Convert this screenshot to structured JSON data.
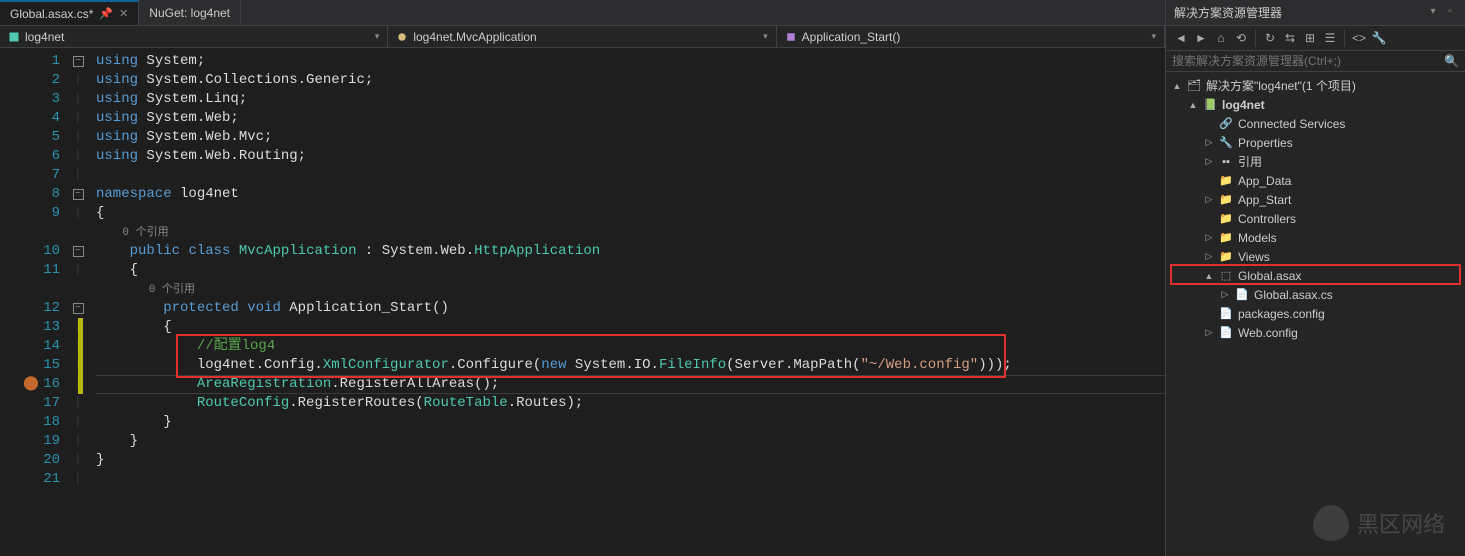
{
  "tabs": [
    {
      "label": "Global.asax.cs*",
      "active": true
    },
    {
      "label": "NuGet: log4net",
      "active": false
    }
  ],
  "navbar": {
    "project": "log4net",
    "class": "log4net.MvcApplication",
    "method": "Application_Start()"
  },
  "refs_text": "0 个引用",
  "code_lines": [
    {
      "n": 1,
      "tokens": [
        {
          "t": "k",
          "v": "using"
        },
        {
          "v": " System;"
        }
      ],
      "fold": "box"
    },
    {
      "n": 2,
      "tokens": [
        {
          "t": "k",
          "v": "using"
        },
        {
          "v": " System.Collections.Generic;"
        }
      ]
    },
    {
      "n": 3,
      "tokens": [
        {
          "t": "k",
          "v": "using"
        },
        {
          "v": " System.Linq;"
        }
      ]
    },
    {
      "n": 4,
      "tokens": [
        {
          "t": "k",
          "v": "using"
        },
        {
          "v": " System.Web;"
        }
      ]
    },
    {
      "n": 5,
      "tokens": [
        {
          "t": "k",
          "v": "using"
        },
        {
          "v": " System.Web.Mvc;"
        }
      ]
    },
    {
      "n": 6,
      "tokens": [
        {
          "t": "k",
          "v": "using"
        },
        {
          "v": " System.Web.Routing;"
        }
      ]
    },
    {
      "n": 7,
      "tokens": []
    },
    {
      "n": 8,
      "tokens": [
        {
          "t": "k",
          "v": "namespace"
        },
        {
          "v": " log4net"
        }
      ],
      "fold": "box"
    },
    {
      "n": 9,
      "tokens": [
        {
          "v": "{"
        }
      ]
    },
    {
      "ref": true
    },
    {
      "n": 10,
      "tokens": [
        {
          "v": "    "
        },
        {
          "t": "k",
          "v": "public"
        },
        {
          "v": " "
        },
        {
          "t": "k",
          "v": "class"
        },
        {
          "v": " "
        },
        {
          "t": "t",
          "v": "MvcApplication"
        },
        {
          "v": " : System.Web."
        },
        {
          "t": "t",
          "v": "HttpApplication"
        }
      ],
      "fold": "box"
    },
    {
      "n": 11,
      "tokens": [
        {
          "v": "    {"
        }
      ]
    },
    {
      "ref": true,
      "indent": "        "
    },
    {
      "n": 12,
      "tokens": [
        {
          "v": "        "
        },
        {
          "t": "k",
          "v": "protected"
        },
        {
          "v": " "
        },
        {
          "t": "k",
          "v": "void"
        },
        {
          "v": " Application_Start()"
        }
      ],
      "fold": "box"
    },
    {
      "n": 13,
      "tokens": [
        {
          "v": "        {"
        }
      ],
      "change": true
    },
    {
      "n": 14,
      "tokens": [
        {
          "v": "            "
        },
        {
          "t": "c",
          "v": "//配置log4"
        }
      ],
      "change": true,
      "hl": "start"
    },
    {
      "n": 15,
      "tokens": [
        {
          "v": "            log4net.Config."
        },
        {
          "t": "t",
          "v": "XmlConfigurator"
        },
        {
          "v": ".Configure("
        },
        {
          "t": "k",
          "v": "new"
        },
        {
          "v": " System.IO."
        },
        {
          "t": "t",
          "v": "FileInfo"
        },
        {
          "v": "(Server.MapPath("
        },
        {
          "t": "s",
          "v": "\"~/Web.config\""
        },
        {
          "v": ")));"
        }
      ],
      "change": true,
      "bp": true,
      "cur": true,
      "hl": "end"
    },
    {
      "n": 16,
      "tokens": [
        {
          "v": "            "
        },
        {
          "t": "t",
          "v": "AreaRegistration"
        },
        {
          "v": ".RegisterAllAreas();"
        }
      ],
      "change": true
    },
    {
      "n": 17,
      "tokens": [
        {
          "v": "            "
        },
        {
          "t": "t",
          "v": "RouteConfig"
        },
        {
          "v": ".RegisterRoutes("
        },
        {
          "t": "t",
          "v": "RouteTable"
        },
        {
          "v": ".Routes);"
        }
      ]
    },
    {
      "n": 18,
      "tokens": [
        {
          "v": "        }"
        }
      ]
    },
    {
      "n": 19,
      "tokens": [
        {
          "v": "    }"
        }
      ]
    },
    {
      "n": 20,
      "tokens": [
        {
          "v": "}"
        }
      ]
    },
    {
      "n": 21,
      "tokens": []
    }
  ],
  "solutionExplorer": {
    "title": "解决方案资源管理器",
    "search_placeholder": "搜索解决方案资源管理器(Ctrl+;)",
    "root_label": "解决方案\"log4net\"(1 个项目)",
    "tree": [
      {
        "depth": 0,
        "arrow": "▲",
        "icon": "sln",
        "label": "解决方案\"log4net\"(1 个项目)",
        "bind": "solutionExplorer.root_label"
      },
      {
        "depth": 1,
        "arrow": "▲",
        "icon": "proj",
        "label": "log4net",
        "bold": true
      },
      {
        "depth": 2,
        "arrow": "",
        "icon": "link",
        "label": "Connected Services"
      },
      {
        "depth": 2,
        "arrow": "▷",
        "icon": "wrench",
        "label": "Properties"
      },
      {
        "depth": 2,
        "arrow": "▷",
        "icon": "ref",
        "label": "引用"
      },
      {
        "depth": 2,
        "arrow": "",
        "icon": "folder",
        "label": "App_Data"
      },
      {
        "depth": 2,
        "arrow": "▷",
        "icon": "folder",
        "label": "App_Start"
      },
      {
        "depth": 2,
        "arrow": "",
        "icon": "folder",
        "label": "Controllers"
      },
      {
        "depth": 2,
        "arrow": "▷",
        "icon": "folder",
        "label": "Models"
      },
      {
        "depth": 2,
        "arrow": "▷",
        "icon": "folder",
        "label": "Views"
      },
      {
        "depth": 2,
        "arrow": "▲",
        "icon": "asax",
        "label": "Global.asax",
        "hl": true
      },
      {
        "depth": 3,
        "arrow": "▷",
        "icon": "cs",
        "label": "Global.asax.cs"
      },
      {
        "depth": 2,
        "arrow": "",
        "icon": "cfg",
        "label": "packages.config"
      },
      {
        "depth": 2,
        "arrow": "▷",
        "icon": "cfg",
        "label": "Web.config"
      }
    ]
  },
  "watermark": "黑区网络"
}
